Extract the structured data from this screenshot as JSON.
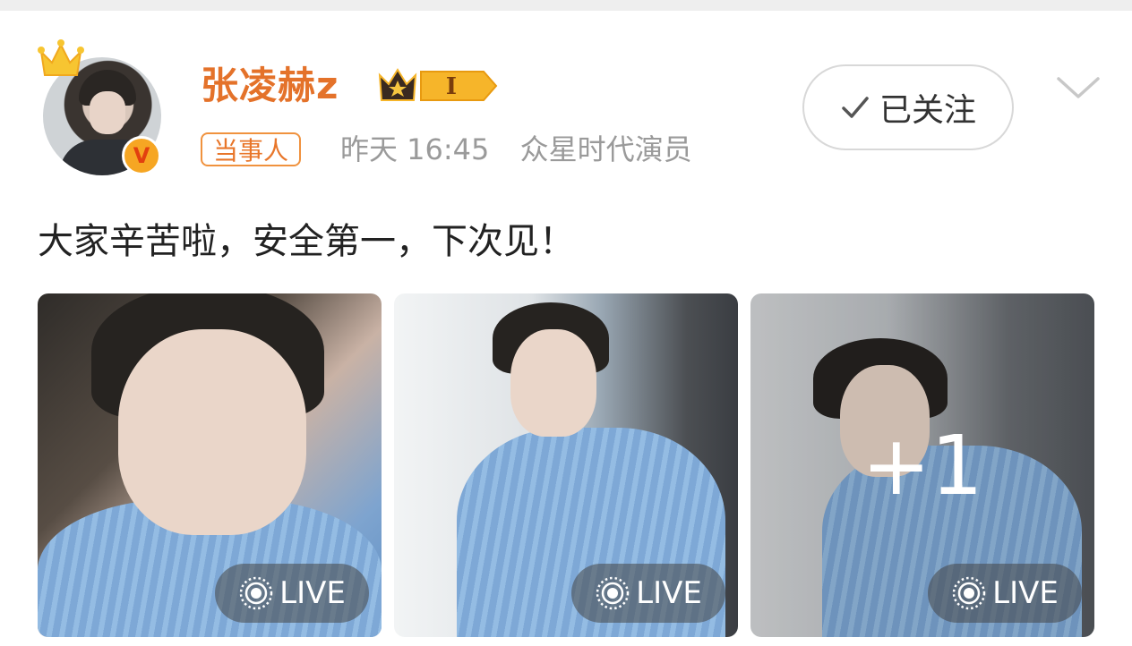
{
  "post": {
    "author": {
      "name": "张凌赫z",
      "verified_letter": "V",
      "vip_level": "I",
      "tag": "当事人"
    },
    "time": "昨天 16:45",
    "source": "众星时代演员",
    "follow_label": "已关注",
    "text": "大家辛苦啦，安全第一，下次见！",
    "images": [
      {
        "live_label": "LIVE"
      },
      {
        "live_label": "LIVE"
      },
      {
        "live_label": "LIVE",
        "more_count": "+1"
      }
    ]
  },
  "icons": {
    "crown": "crown-icon",
    "check": "check-icon",
    "chevron": "chevron-down-icon",
    "live": "live-photo-icon"
  },
  "colors": {
    "username": "#e4722a",
    "tag_border": "#f0923e",
    "meta_text": "#9a9a9a",
    "vip_gold": "#f6b52a"
  }
}
